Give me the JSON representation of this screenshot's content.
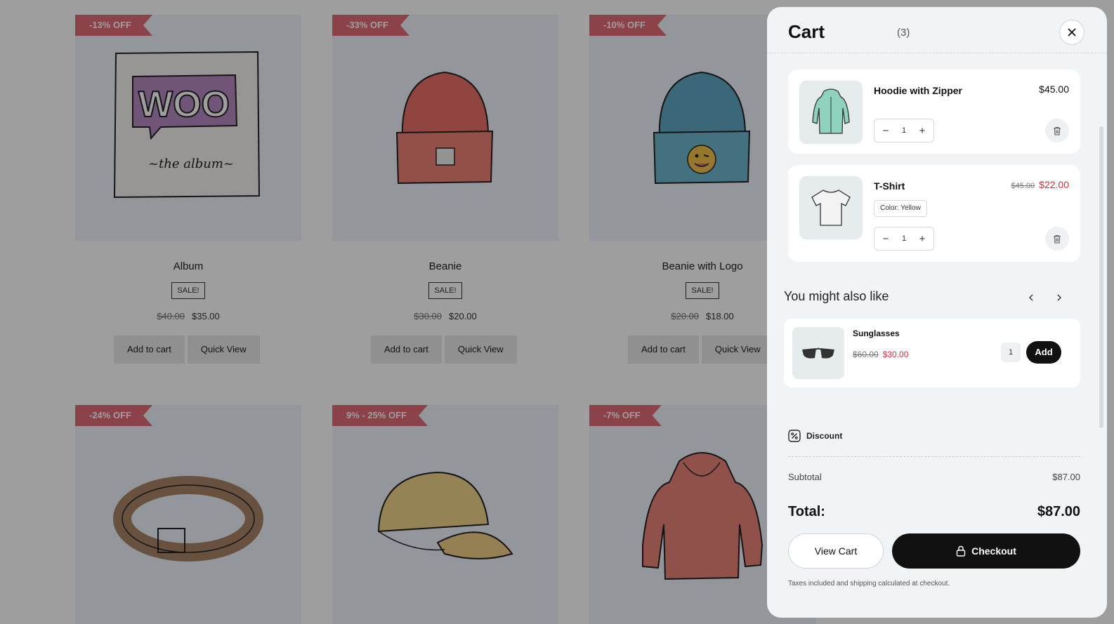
{
  "store": {
    "products": [
      {
        "badge": "-13% OFF",
        "name": "Album",
        "sale": "SALE!",
        "old_price": "$40.00",
        "price": "$35.00",
        "add_label": "Add to cart",
        "quick_label": "Quick View",
        "art": "album"
      },
      {
        "badge": "-33% OFF",
        "name": "Beanie",
        "sale": "SALE!",
        "old_price": "$30.00",
        "price": "$20.00",
        "add_label": "Add to cart",
        "quick_label": "Quick View",
        "art": "beanie"
      },
      {
        "badge": "-10% OFF",
        "name": "Beanie with Logo",
        "sale": "SALE!",
        "old_price": "$20.00",
        "price": "$18.00",
        "add_label": "Add to cart",
        "quick_label": "Quick View",
        "art": "beanie-logo"
      },
      {
        "badge": "-24% OFF",
        "art": "belt"
      },
      {
        "badge": "9% - 25% OFF",
        "art": "cap"
      },
      {
        "badge": "-7% OFF",
        "art": "hoodie"
      }
    ]
  },
  "cart": {
    "title": "Cart",
    "count": "(3)",
    "items": [
      {
        "name": "Hoodie with Zipper",
        "price": "$45.00",
        "qty": "1",
        "icon": "hoodie-zipper-icon"
      },
      {
        "name": "T-Shirt",
        "old_price": "$45.00",
        "price": "$22.00",
        "attribute": "Color: Yellow",
        "qty": "1",
        "icon": "tshirt-icon"
      }
    ],
    "upsell": {
      "title": "You might also like",
      "product": {
        "name": "Sunglasses",
        "old_price": "$60.00",
        "price": "$30.00",
        "qty": "1",
        "add_label": "Add"
      }
    },
    "discount_label": "Discount",
    "subtotal_label": "Subtotal",
    "subtotal": "$87.00",
    "total_label": "Total:",
    "total": "$87.00",
    "view_cart_label": "View Cart",
    "checkout_label": "Checkout",
    "note": "Taxes included and shipping calculated at checkout."
  },
  "colors": {
    "ribbon": "#e06b74",
    "sale_price": "#d0303a",
    "primary_button": "#111111",
    "drawer_bg": "#f1f4f6"
  }
}
